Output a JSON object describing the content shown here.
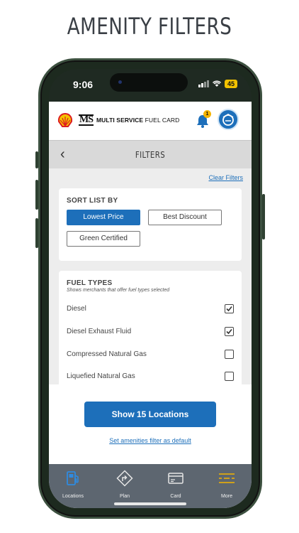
{
  "headline": "AMENITY FILTERS",
  "status_bar": {
    "time": "9:06",
    "battery": "45"
  },
  "app_header": {
    "brand_mark": "MS",
    "brand_name_bold": "MULTI SERVICE",
    "brand_name_light": "FUEL CARD",
    "notification_count": "1"
  },
  "subheader": {
    "back_glyph": "‹",
    "title": "FILTERS"
  },
  "clear_filters": "Clear Filters",
  "sort": {
    "title": "SORT LIST BY",
    "options": [
      "Lowest Price",
      "Best Discount",
      "Green Certified"
    ],
    "selected": "Lowest Price"
  },
  "fuel_types": {
    "title": "FUEL TYPES",
    "description": "Shows merchants that offer fuel types selected",
    "items": [
      {
        "label": "Diesel",
        "checked": true
      },
      {
        "label": "Diesel Exhaust Fluid",
        "checked": true
      },
      {
        "label": "Compressed Natural Gas",
        "checked": false
      },
      {
        "label": "Liquefied Natural Gas",
        "checked": false
      }
    ]
  },
  "show_button": "Show 15 Locations",
  "set_default_link": "Set amenities filter as default",
  "tabs": [
    {
      "label": "Locations",
      "icon": "fuel-pump-icon",
      "active": true
    },
    {
      "label": "Plan",
      "icon": "route-sign-icon",
      "active": false
    },
    {
      "label": "Card",
      "icon": "card-icon",
      "active": false
    },
    {
      "label": "More",
      "icon": "menu-icon",
      "active": false
    }
  ],
  "colors": {
    "accent": "#1d6fba",
    "tabbar": "#5d6670",
    "battery": "#f2c200",
    "badge": "#f4b400",
    "menu_lines": "#f4b400"
  }
}
